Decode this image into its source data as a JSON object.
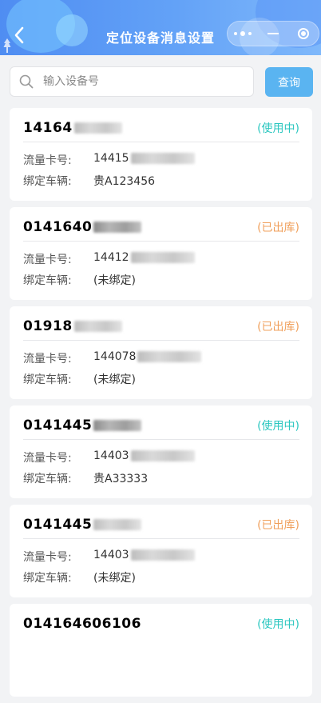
{
  "header": {
    "title": "定位设备消息设置",
    "back_icon": "chevron-left-icon",
    "capsule_icons": [
      "more-dots-icon",
      "minimize-icon",
      "target-icon"
    ]
  },
  "search": {
    "placeholder": "输入设备号",
    "value": "",
    "button_label": "查询"
  },
  "labels": {
    "sim": "流量卡号:",
    "vehicle": "绑定车辆:"
  },
  "colors": {
    "in_use": "#2cc7c0",
    "stocked_out": "#f0a05c",
    "accent": "#5ab4f1"
  },
  "devices": [
    {
      "device_no": "14164",
      "status": "(使用中)",
      "status_type": "in-use",
      "sim_no": "14415",
      "vehicle": "贵A123456"
    },
    {
      "device_no": "0141640",
      "status": "(已出库)",
      "status_type": "out",
      "sim_no": "14412",
      "vehicle": "(未绑定)"
    },
    {
      "device_no": "01918",
      "status": "(已出库)",
      "status_type": "out",
      "sim_no": "144078",
      "vehicle": "(未绑定)"
    },
    {
      "device_no": "0141445",
      "status": "(使用中)",
      "status_type": "in-use",
      "sim_no": "14403",
      "vehicle": "贵A33333"
    },
    {
      "device_no": "0141445",
      "status": "(已出库)",
      "status_type": "out",
      "sim_no": "14403",
      "vehicle": "(未绑定)"
    },
    {
      "device_no": "014164606106",
      "status": "(使用中)",
      "status_type": "in-use",
      "sim_no": "",
      "vehicle": ""
    }
  ]
}
